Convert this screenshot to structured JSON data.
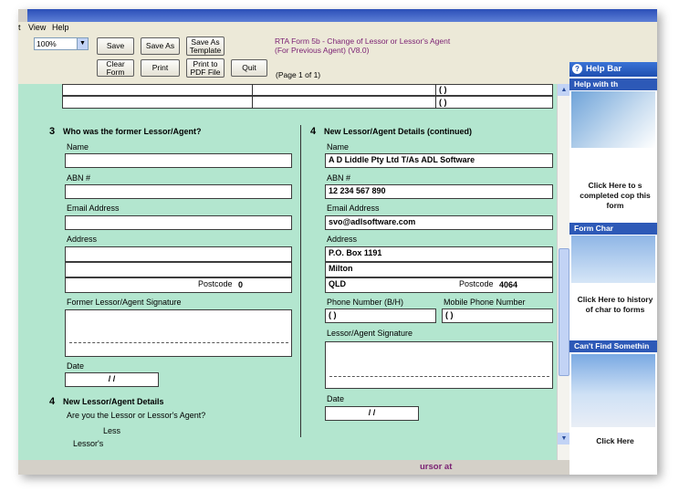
{
  "menu": {
    "edit_partial": "t",
    "view": "View",
    "help": "Help"
  },
  "toolbar": {
    "zoom_value": "100%",
    "save": "Save",
    "save_as": "Save As",
    "save_as_template": "Save As Template",
    "clear_form": "Clear Form",
    "print": "Print",
    "print_pdf": "Print to PDF File",
    "quit": "Quit"
  },
  "form_title": "RTA Form  5b - Change of Lessor or Lessor's Agent (For Previous Agent) (V8.0)",
  "page_indicator": "(Page 1 of 1)",
  "top_rows": {
    "phone1": "(    )",
    "phone2": "(    )"
  },
  "section3": {
    "number": "3",
    "title": "Who was the former Lessor/Agent?",
    "name_label": "Name",
    "name_value": "",
    "abn_label": "ABN #",
    "abn_value": "",
    "email_label": "Email Address",
    "email_value": "",
    "address_label": "Address",
    "postcode_label": "Postcode",
    "postcode_value": "0",
    "signature_label": "Former Lessor/Agent Signature",
    "date_label": "Date",
    "date_value": "/    /"
  },
  "section4_left": {
    "number": "4",
    "title": "New Lessor/Agent Details",
    "question": "Are you the Lessor or Lessor's Agent?",
    "option1": "Less",
    "option2": "Lessor's"
  },
  "section4_right": {
    "number": "4",
    "title": "New Lessor/Agent Details (continued)",
    "name_label": "Name",
    "name_value": "A D Liddle Pty Ltd T/As ADL Software",
    "abn_label": "ABN #",
    "abn_value": "12 234 567 890",
    "email_label": "Email Address",
    "email_value": "svo@adlsoftware.com",
    "address_label": "Address",
    "address_line1": "P.O. Box 1191",
    "address_line2": "Milton",
    "address_line3": "QLD",
    "postcode_label": "Postcode",
    "postcode_value": "4064",
    "phone_bh_label": "Phone Number (B/H)",
    "phone_bh_value": "(    )",
    "mobile_label": "Mobile Phone Number",
    "mobile_value": "(    )",
    "signature_label": "Lessor/Agent Signature",
    "date_label": "Date",
    "date_value": "/    /"
  },
  "status_text": "ursor at",
  "help_panel": {
    "title": "Help Bar",
    "section1_head": "Help with th",
    "section1_text": "Click Here to s completed cop this form",
    "section2_head": "Form Char",
    "section2_text": "Click Here to history of char to forms",
    "section3_head": "Can't Find Somethin",
    "section3_text": "Click Here"
  }
}
